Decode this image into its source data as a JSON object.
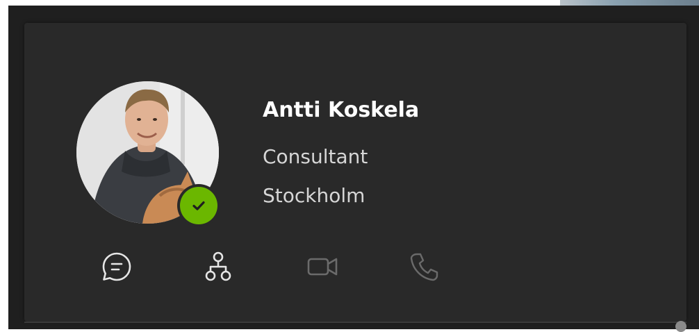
{
  "profile": {
    "name": "Antti Koskela",
    "title": "Consultant",
    "location": "Stockholm",
    "presence": "available"
  },
  "actions": [
    {
      "icon": "chat-icon",
      "enabled": true
    },
    {
      "icon": "org-chart-icon",
      "enabled": true
    },
    {
      "icon": "video-call-icon",
      "enabled": false
    },
    {
      "icon": "phone-call-icon",
      "enabled": false
    }
  ],
  "colors": {
    "card": "#292929",
    "background": "#1f1f1f",
    "presence": "#6bb700",
    "text_primary": "#ffffff",
    "text_secondary": "#d6d6d6",
    "icon_enabled": "#e6e6e6",
    "icon_disabled": "#6b6b6b"
  }
}
